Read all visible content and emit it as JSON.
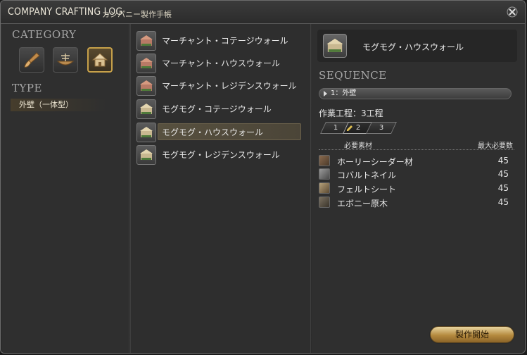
{
  "window": {
    "title": "COMPANY CRAFTING LOG",
    "subtitle": "カンパニー製作手帳"
  },
  "left": {
    "category_title": "CATEGORY",
    "categories": [
      {
        "icon": "brush-icon",
        "selected": false
      },
      {
        "icon": "airship-icon",
        "selected": false
      },
      {
        "icon": "house-icon",
        "selected": true
      }
    ],
    "type_title": "TYPE",
    "type_item": "外壁（一体型）"
  },
  "recipes": [
    {
      "label": "マーチャント・コテージウォール",
      "selected": false
    },
    {
      "label": "マーチャント・ハウスウォール",
      "selected": false
    },
    {
      "label": "マーチャント・レジデンスウォール",
      "selected": false
    },
    {
      "label": "モグモグ・コテージウォール",
      "selected": false
    },
    {
      "label": "モグモグ・ハウスウォール",
      "selected": true
    },
    {
      "label": "モグモグ・レジデンスウォール",
      "selected": false
    }
  ],
  "detail": {
    "item_name": "モグモグ・ハウスウォール",
    "sequence_title": "SEQUENCE",
    "sequence_item": "1：外壁",
    "steps_label": "作業工程：3工程",
    "steps": [
      "1",
      "2",
      "3"
    ],
    "active_step": "2",
    "materials_header": "必要素材",
    "max_header": "最大必要数",
    "materials": [
      {
        "name": "ホーリーシーダー材",
        "qty": "45"
      },
      {
        "name": "コバルトネイル",
        "qty": "45"
      },
      {
        "name": "フェルトシート",
        "qty": "45"
      },
      {
        "name": "エボニー原木",
        "qty": "45"
      }
    ],
    "craft_button": "製作開始"
  }
}
